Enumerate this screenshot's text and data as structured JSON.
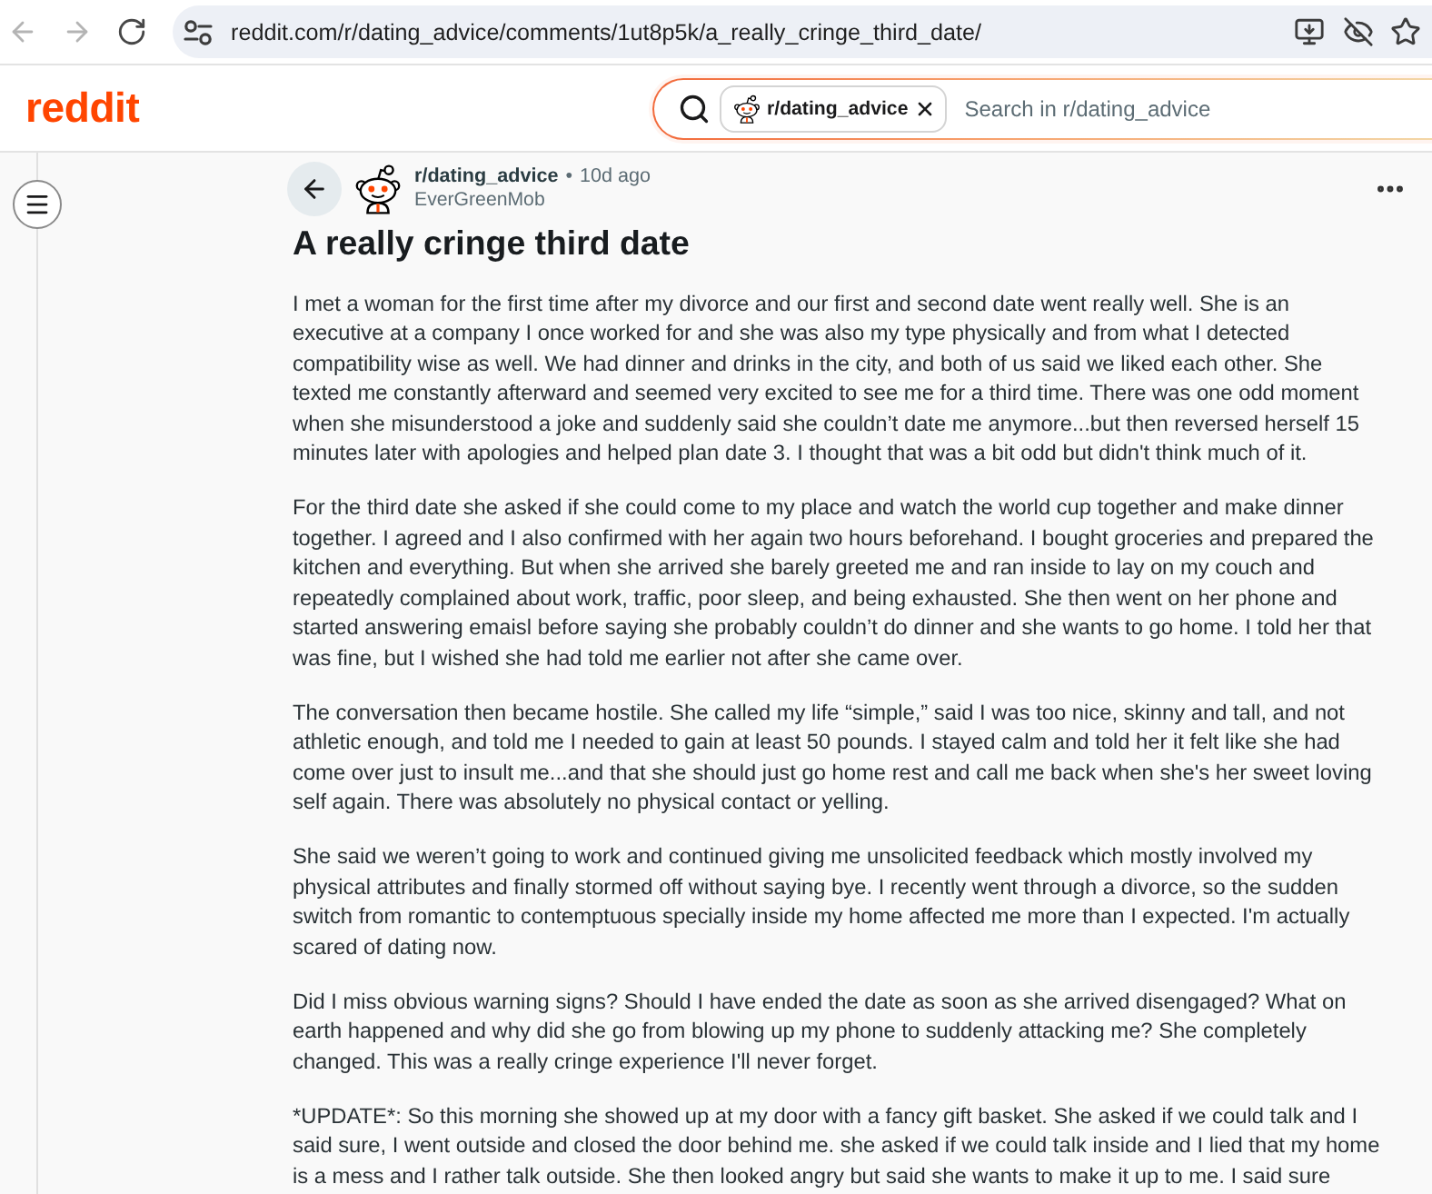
{
  "browser": {
    "nav_buttons": [
      {
        "kind": "back",
        "disabled": true
      },
      {
        "kind": "forward",
        "disabled": true
      },
      {
        "kind": "reload",
        "disabled": false
      }
    ],
    "url": "reddit.com/r/dating_advice/comments/1ut8p5k/a_really_cringe_third_date/"
  },
  "header": {
    "logo": "reddit",
    "search": {
      "community": "r/dating_advice",
      "placeholder": "Search in r/dating_advice"
    }
  },
  "post": {
    "subreddit": "r/dating_advice",
    "separator": "•",
    "time": "10d ago",
    "author": "EverGreenMob",
    "title": "A really cringe third date",
    "paragraphs": [
      "I met a woman for the first time after my divorce and our first and second date went really well. She is an executive at a company I once worked for and she was also my type physically and from what I detected compatibility wise as well. We had dinner and drinks in the city, and both of us said we liked each other. She texted me constantly afterward and seemed very excited to see me for a third time. There was one odd moment when she misunderstood a joke and suddenly said she couldn’t date me anymore...but then reversed herself 15 minutes later with apologies and helped plan date 3. I thought that was a bit odd but didn't think much of it.",
      "For the third date she asked if she could come to my place and watch the world cup together and make dinner together. I agreed and I also confirmed with her again two hours beforehand. I bought groceries and prepared the kitchen and everything. But when she arrived she barely greeted me and ran inside to lay on my couch and repeatedly complained about work, traffic, poor sleep, and being exhausted. She then went on her phone and started answering emaisl before saying she probably couldn’t do dinner and she wants to go home. I told her that was fine, but I wished she had told me earlier not after she came over.",
      "The conversation then became hostile. She called my life “simple,” said I was too nice, skinny and tall, and not athletic enough, and told me I needed to gain at least 50 pounds. I stayed calm and told her it felt like she had come over just to insult me...and that she should just go home rest and call me back when she's her sweet loving self again. There was absolutely no physical contact or yelling.",
      "She said we weren’t going to work and continued giving me unsolicited feedback which mostly involved my physical attributes and finally stormed off without saying bye. I recently went through a divorce, so the sudden switch from romantic to contemptuous specially inside my home affected me more than I expected. I'm actually scared of dating now.",
      "Did I miss obvious warning signs? Should I have ended the date as soon as she arrived disengaged? What on earth happened and why did she go from blowing up my phone to suddenly attacking me? She completely changed. This was a really cringe experience I'll never forget.",
      "*UPDATE*: So this morning she showed up at my door with a fancy gift basket. She asked if we could talk and I said sure, I went outside and closed the door behind me. she asked if we could talk inside and I lied that my home is a mess and I rather talk outside. She then looked angry but said she wants to make it up to me. I said sure"
    ]
  }
}
